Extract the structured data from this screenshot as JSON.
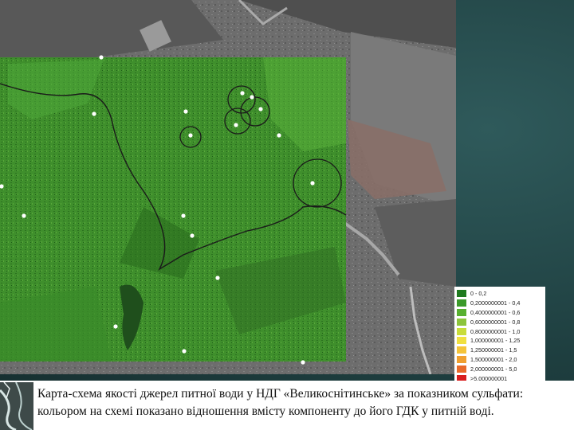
{
  "legend": {
    "items": [
      {
        "label": "0 - 0,2",
        "color": "#1f7a1f"
      },
      {
        "label": "0,2000000001 - 0,4",
        "color": "#3b9a2a"
      },
      {
        "label": "0,4000000001 - 0,6",
        "color": "#58b030"
      },
      {
        "label": "0,6000000001 - 0,8",
        "color": "#8cc43c"
      },
      {
        "label": "0,8000000001 - 1,0",
        "color": "#c8dc3a"
      },
      {
        "label": "1,000000001 - 1,25",
        "color": "#f0e040"
      },
      {
        "label": "1,250000001 - 1,5",
        "color": "#f4c43a"
      },
      {
        "label": "1,500000001 - 2,0",
        "color": "#f0a030"
      },
      {
        "label": "2,000000001 - 5,0",
        "color": "#e86a2a"
      },
      {
        "label": ">5,000000001",
        "color": "#d81e1e"
      }
    ]
  },
  "caption": {
    "line1": "Карта-схема якості джерел питної води у НДГ «Великоснітинське» за показником сульфати:",
    "line2": "кольором на схемі показано відношення вмісту компоненту до його ГДК у питній воді."
  }
}
